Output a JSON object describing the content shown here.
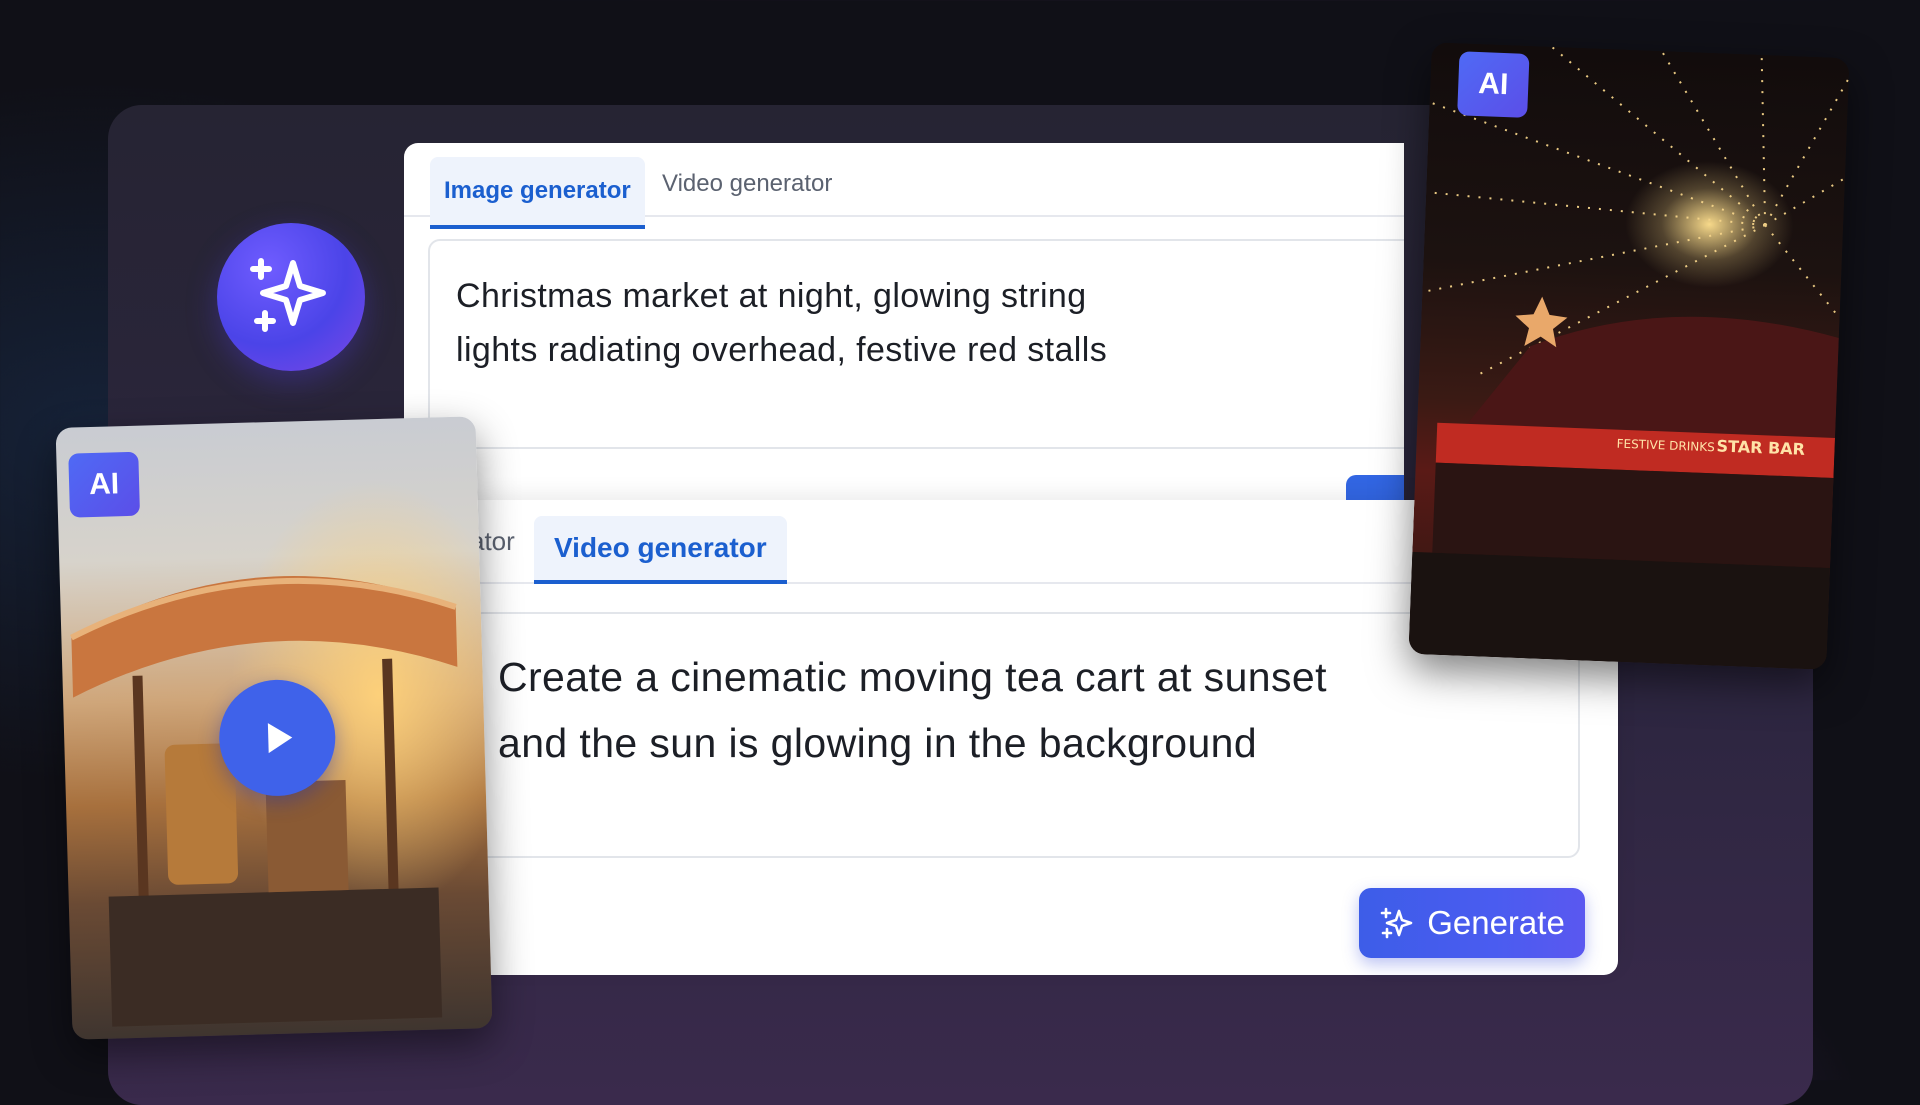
{
  "image_panel": {
    "tabs": [
      {
        "label": "Image generator",
        "active": true
      },
      {
        "label": "Video generator",
        "active": false
      }
    ],
    "prompt_line1": "Christmas market at night, glowing string",
    "prompt_line2": "lights radiating overhead, festive red stalls"
  },
  "video_panel": {
    "tab_partial": "ator",
    "tab_active": "Video generator",
    "prompt_line1": "Create a cinematic moving tea cart at sunset",
    "prompt_line2": "and the sun is glowing in the background",
    "generate_label": "Generate"
  },
  "cards": {
    "left_badge": "AI",
    "right_badge": "AI",
    "right_sign": "STAR BAR",
    "right_sign2": "FESTIVE DRINKS"
  },
  "colors": {
    "accent": "#1b5fcf",
    "button": "#3d5de8",
    "badge": "#4f6af5"
  }
}
